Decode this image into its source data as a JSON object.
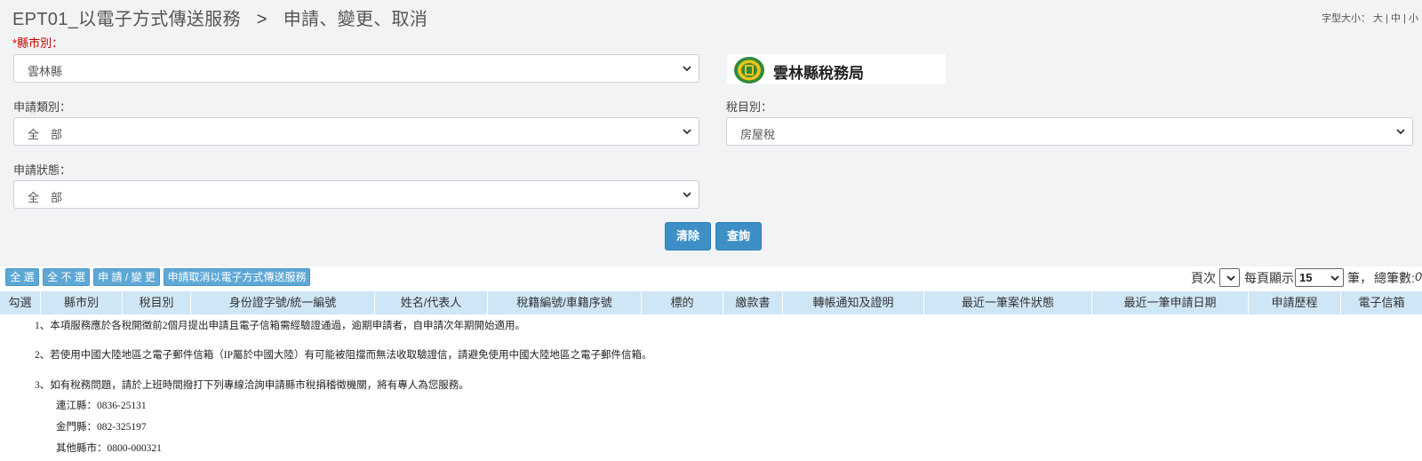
{
  "header": {
    "code": "EPT01_以電子方式傳送服務",
    "separator": ">",
    "subtitle": "申請、變更、取消",
    "font_size_label": "字型大小：",
    "font_large": "大",
    "font_medium": "中",
    "font_small": "小",
    "divider": "|"
  },
  "form": {
    "county": {
      "required_mark": "*",
      "label": "縣市別：",
      "value": "雲林縣"
    },
    "logo_text": "雲林縣稅務局",
    "apply_type": {
      "label": "申請類別：",
      "value": "全　部"
    },
    "tax_item": {
      "label": "稅目別：",
      "value": "房屋稅"
    },
    "apply_status": {
      "label": "申請狀態：",
      "value": "全　部"
    }
  },
  "buttons": {
    "clear": "清除",
    "query": "查詢",
    "select_all": "全 選",
    "select_none": "全 不 選",
    "apply_change": "申 請 / 變 更",
    "cancel_service": "申請取消以電子方式傳送服務"
  },
  "pager": {
    "page_label": "頁次",
    "page_value": "",
    "per_page_label": "每頁顯示",
    "per_page_value": "15",
    "unit": "筆，",
    "total_label": "總筆數:",
    "total_value": "0"
  },
  "table": {
    "columns": [
      "勾選",
      "縣市別",
      "稅目別",
      "身份證字號/統一編號",
      "姓名/代表人",
      "稅籍編號/車籍序號",
      "標的",
      "繳款書",
      "轉帳通知及證明",
      "最近一筆案件狀態",
      "最近一筆申請日期",
      "申請歷程",
      "電子信箱"
    ]
  },
  "notes": {
    "n1": "1、本項服務應於各稅開徵前2個月提出申請且電子信箱需經驗證通過，逾期申請者，自申請次年期開始適用。",
    "n2": "2、若使用中國大陸地區之電子郵件信箱（IP屬於中國大陸）有可能被阻擋而無法收取驗證信，請避免使用中國大陸地區之電子郵件信箱。",
    "n3": "3、如有稅務問題，請於上班時間撥打下列專線洽詢申請縣市稅捐稽徵機關，將有專人為您服務。",
    "lienchiang": "連江縣：0836-25131",
    "kinmen": "金門縣：082-325197",
    "others": "其他縣市：0800-000321"
  },
  "colors": {
    "primary_button": "#3d8fc6",
    "small_button": "#5ea8d6",
    "table_header": "#cfe6f6",
    "required": "#cc0000"
  }
}
